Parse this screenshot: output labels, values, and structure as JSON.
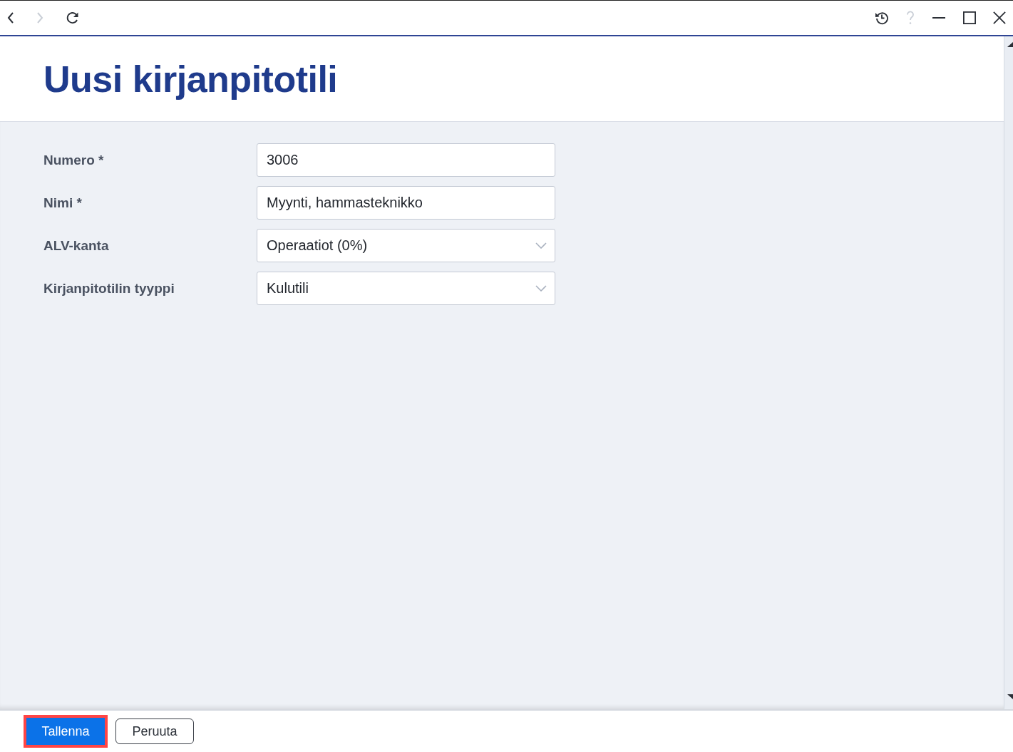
{
  "toolbar": {
    "nav_buttons": [
      {
        "kind": "back",
        "disabled": false
      },
      {
        "kind": "forward",
        "disabled": true
      },
      {
        "kind": "refresh",
        "disabled": false
      }
    ],
    "window_buttons": [
      {
        "kind": "history",
        "disabled": false
      },
      {
        "kind": "help",
        "disabled": true
      },
      {
        "kind": "minimize",
        "disabled": false
      },
      {
        "kind": "maximize",
        "disabled": false
      },
      {
        "kind": "close",
        "disabled": false
      }
    ]
  },
  "header": {
    "title": "Uusi kirjanpitotili"
  },
  "form": {
    "fields": [
      {
        "kind": "text",
        "label": "Numero *",
        "value": "3006"
      },
      {
        "kind": "text",
        "label": "Nimi *",
        "value": "Myynti, hammasteknikko"
      },
      {
        "kind": "select",
        "label": "ALV-kanta",
        "value": "Operaatiot (0%)"
      },
      {
        "kind": "select",
        "label": "Kirjanpitotilin tyyppi",
        "value": "Kulutili"
      }
    ]
  },
  "footer": {
    "buttons": [
      {
        "kind": "primary",
        "label": "Tallenna",
        "highlighted": true
      },
      {
        "kind": "secondary",
        "label": "Peruuta",
        "highlighted": false
      }
    ]
  }
}
